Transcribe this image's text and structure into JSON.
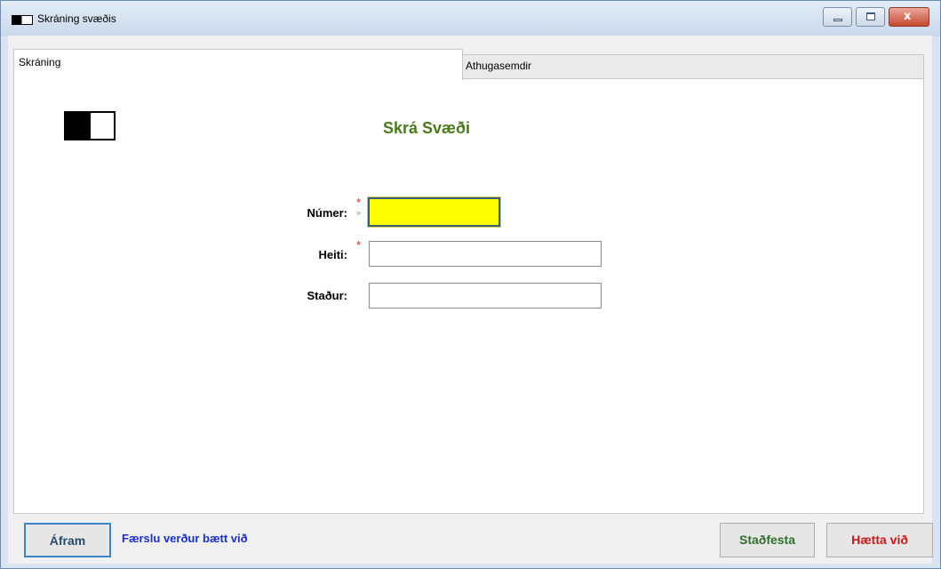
{
  "window": {
    "title": "Skráning svæðis",
    "close_glyph": "x",
    "icons": {
      "app": "window-app-icon",
      "minimize": "minimize-icon",
      "maximize": "maximize-icon",
      "close": "close-icon"
    }
  },
  "tabs": [
    {
      "label": "Skráning",
      "active": true
    },
    {
      "label": "Athugasemdir",
      "active": false
    }
  ],
  "form": {
    "title": "Skrá Svæði",
    "title_color": "#4a7a1c",
    "required_mark": "*",
    "focus_marker": "»",
    "fields": [
      {
        "label": "Númer:",
        "value": "",
        "required": true,
        "focused": true
      },
      {
        "label": "Heiti:",
        "value": "",
        "required": true,
        "focused": false
      },
      {
        "label": "Staður:",
        "value": "",
        "required": false,
        "focused": false
      }
    ]
  },
  "footer": {
    "next_label": "Áfram",
    "status": "Færslu verður bætt við",
    "confirm_label": "Staðfesta",
    "cancel_label": "Hætta við"
  },
  "colors": {
    "active_field_bg": "#ffff00",
    "status_text": "#1a2fd0",
    "confirm_text": "#2f6f2f",
    "cancel_text": "#cc1a1a",
    "required": "#e02020"
  }
}
